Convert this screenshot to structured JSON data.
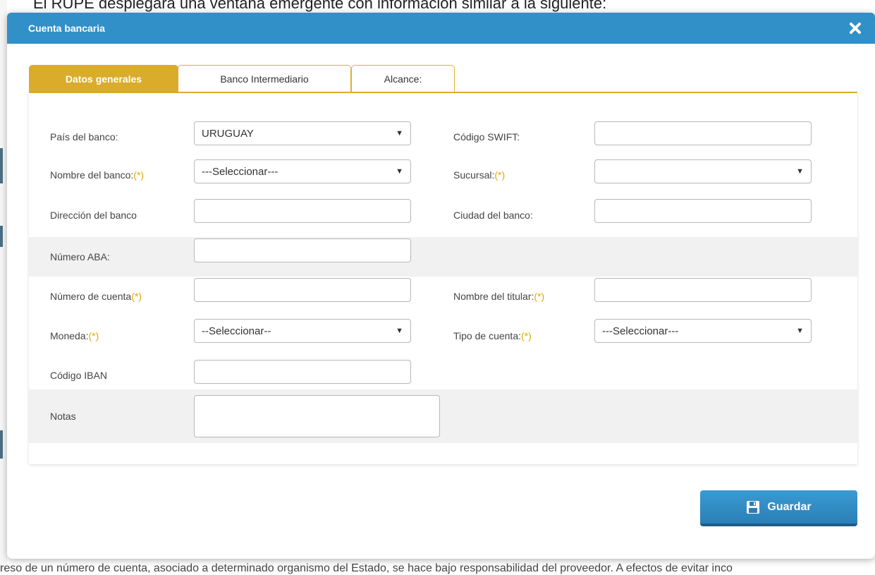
{
  "background": {
    "top_text": "El RUPE desplegará una ventana emergente con información similar a la siguiente:",
    "bottom_text": "reso de un número de cuenta, asociado a determinado organismo del Estado, se hace bajo responsabilidad del proveedor. A efectos de evitar inco"
  },
  "modal": {
    "title": "Cuenta bancaria",
    "close_icon": "close-icon"
  },
  "tabs": [
    {
      "label": "Datos generales",
      "active": true
    },
    {
      "label": "Banco Intermediario",
      "active": false
    },
    {
      "label": "Alcance:",
      "active": false
    }
  ],
  "form": {
    "required_marker": "(*)",
    "pais_label": "País del banco:",
    "pais_value": "URUGUAY",
    "swift_label": "Código SWIFT:",
    "swift_value": "",
    "nombre_banco_label": "Nombre del banco:",
    "nombre_banco_value": "---Seleccionar---",
    "sucursal_label": "Sucursal:",
    "sucursal_value": "",
    "direccion_label": "Dirección del banco",
    "direccion_value": "",
    "ciudad_label": "Ciudad del banco:",
    "ciudad_value": "",
    "aba_label": "Número ABA:",
    "aba_value": "",
    "cuenta_label": "Número de cuenta",
    "cuenta_value": "",
    "titular_label": "Nombre del titular:",
    "titular_value": "",
    "moneda_label": "Moneda:",
    "moneda_value": "--Seleccionar--",
    "tipo_cuenta_label": "Tipo de cuenta:",
    "tipo_cuenta_value": "---Seleccionar---",
    "iban_label": "Código IBAN",
    "iban_value": "",
    "notas_label": "Notas",
    "notas_value": ""
  },
  "save_button": {
    "label": "Guardar",
    "icon": "floppy-disk-icon"
  },
  "colors": {
    "header": "#3190c7",
    "tab_active": "#d9ac2b",
    "required": "#e0a800",
    "button": "#2b88c2"
  }
}
